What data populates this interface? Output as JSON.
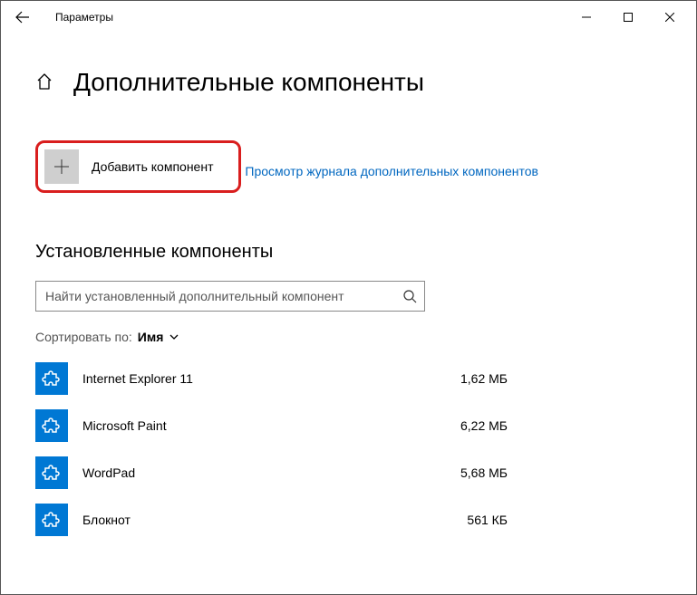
{
  "window": {
    "title": "Параметры"
  },
  "page": {
    "title": "Дополнительные компоненты"
  },
  "actions": {
    "add_label": "Добавить компонент",
    "history_link": "Просмотр журнала дополнительных компонентов"
  },
  "installed": {
    "section_label": "Установленные компоненты",
    "search_placeholder": "Найти установленный дополнительный компонент",
    "sort_label": "Сортировать по:",
    "sort_value": "Имя",
    "items": [
      {
        "name": "Internet Explorer 11",
        "size": "1,62 МБ"
      },
      {
        "name": "Microsoft Paint",
        "size": "6,22 МБ"
      },
      {
        "name": "WordPad",
        "size": "5,68 МБ"
      },
      {
        "name": "Блокнот",
        "size": "561 КБ"
      }
    ]
  }
}
